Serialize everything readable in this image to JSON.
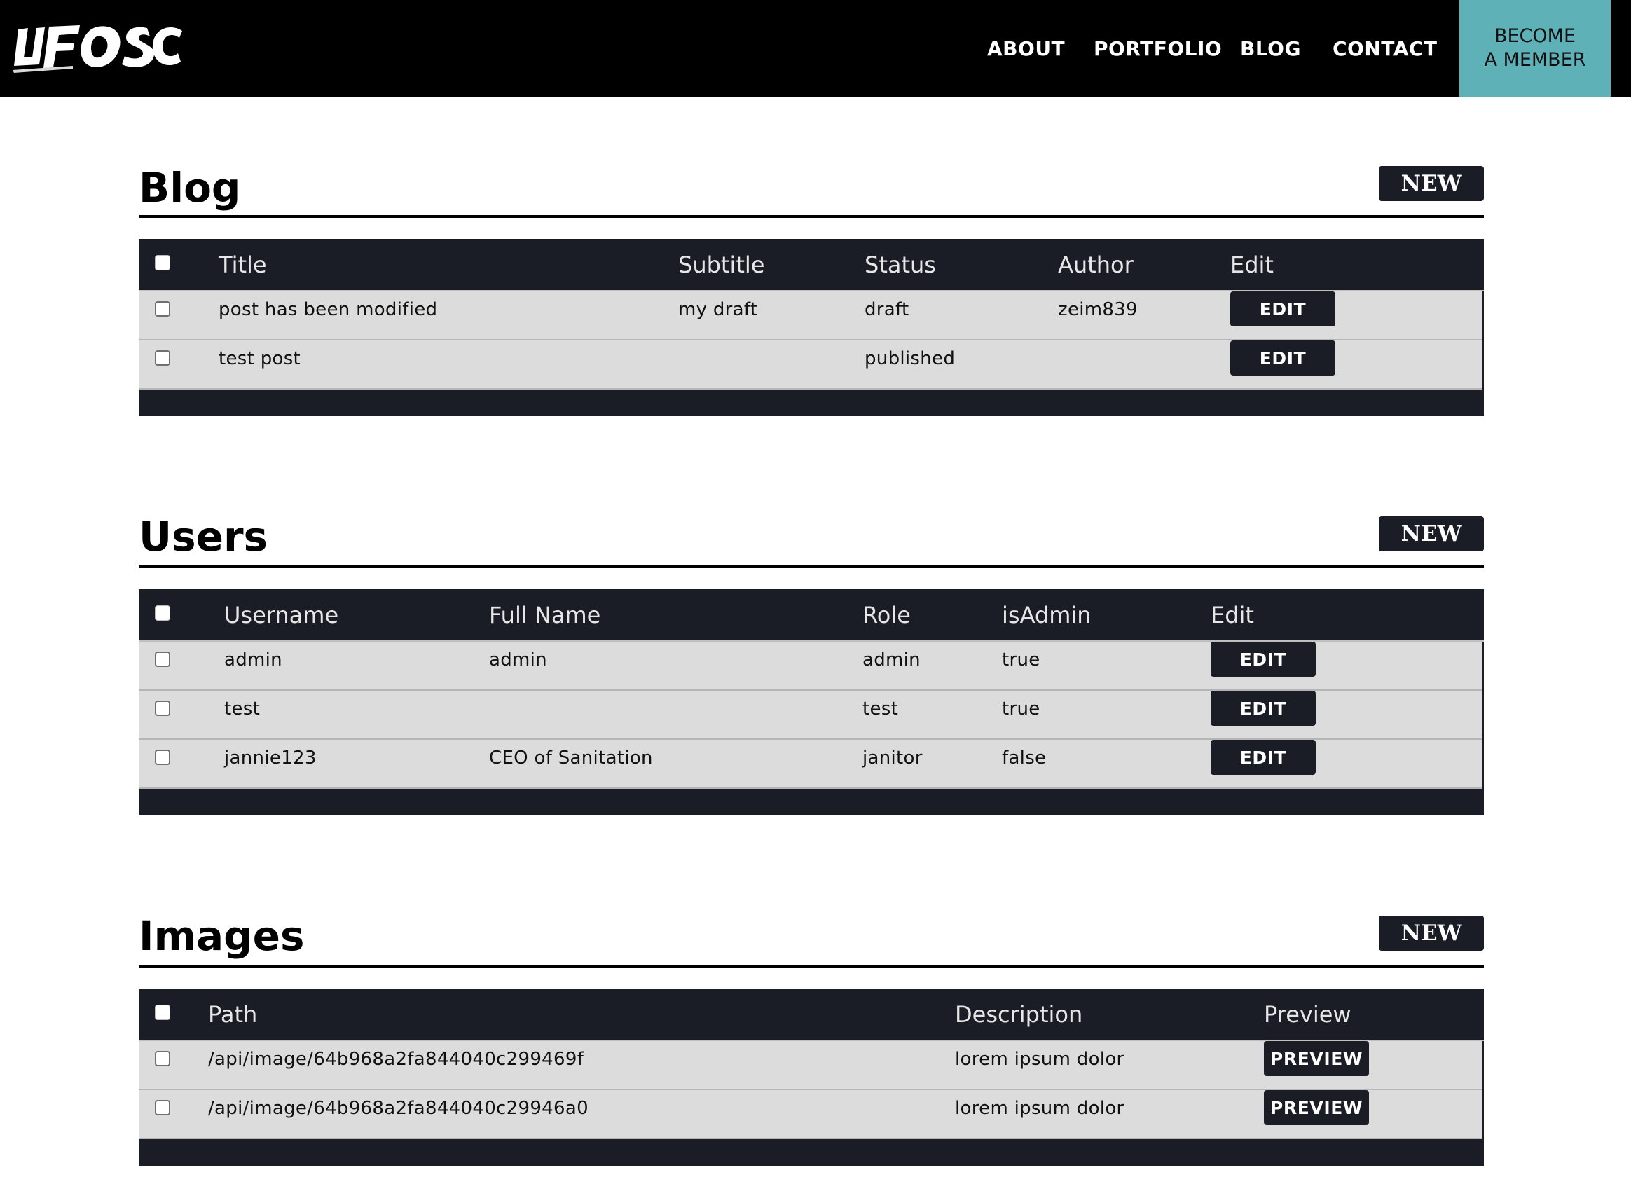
{
  "header": {
    "logo_text": "UF OSC",
    "nav": [
      "ABOUT",
      "PORTFOLIO",
      "BLOG",
      "CONTACT"
    ],
    "cta_line1": "BECOME",
    "cta_line2": "A MEMBER"
  },
  "blog": {
    "title": "Blog",
    "new_label": "NEW",
    "columns": [
      "Title",
      "Subtitle",
      "Status",
      "Author",
      "Edit"
    ],
    "rows": [
      {
        "title": "post has been modified",
        "subtitle": "my draft",
        "status": "draft",
        "author": "zeim839",
        "action": "EDIT"
      },
      {
        "title": "test post",
        "subtitle": "",
        "status": "published",
        "author": "",
        "action": "EDIT"
      }
    ]
  },
  "users": {
    "title": "Users",
    "new_label": "NEW",
    "columns": [
      "Username",
      "Full Name",
      "Role",
      "isAdmin",
      "Edit"
    ],
    "rows": [
      {
        "username": "admin",
        "full_name": "admin",
        "role": "admin",
        "is_admin": "true",
        "action": "EDIT"
      },
      {
        "username": "test",
        "full_name": "",
        "role": "test",
        "is_admin": "true",
        "action": "EDIT"
      },
      {
        "username": "jannie123",
        "full_name": "CEO of Sanitation",
        "role": "janitor",
        "is_admin": "false",
        "action": "EDIT"
      }
    ]
  },
  "images": {
    "title": "Images",
    "new_label": "NEW",
    "columns": [
      "Path",
      "Description",
      "Preview"
    ],
    "rows": [
      {
        "path": "/api/image/64b968a2fa844040c299469f",
        "description": "lorem ipsum dolor",
        "action": "PREVIEW"
      },
      {
        "path": "/api/image/64b968a2fa844040c29946a0",
        "description": "lorem ipsum dolor",
        "action": "PREVIEW"
      }
    ]
  },
  "colors": {
    "accent": "#5eb1b6",
    "dark": "#1a1d26",
    "row_bg": "#dcdcdc"
  }
}
